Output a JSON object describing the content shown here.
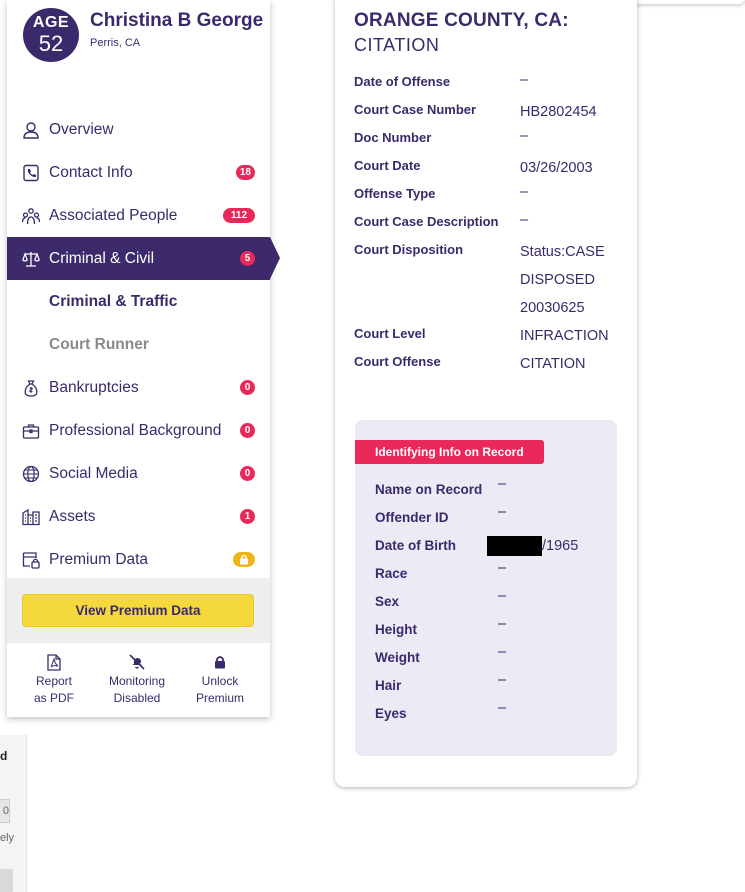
{
  "profile": {
    "age_label": "AGE",
    "age_value": "52",
    "name": "Christina B George",
    "location": "Perris, CA"
  },
  "nav": {
    "overview": {
      "label": "Overview",
      "icon": "person-icon"
    },
    "contact": {
      "label": "Contact Info",
      "badge": "18",
      "icon": "phone-icon"
    },
    "associated": {
      "label": "Associated People",
      "badge": "112",
      "icon": "people-icon"
    },
    "criminal": {
      "label": "Criminal & Civil",
      "badge": "5",
      "icon": "scales-icon"
    },
    "sub_criminal_traffic": "Criminal & Traffic",
    "sub_court_runner": "Court Runner",
    "bankruptcies": {
      "label": "Bankruptcies",
      "badge": "0",
      "icon": "money-bag-icon"
    },
    "professional": {
      "label": "Professional Background",
      "badge": "0",
      "icon": "briefcase-icon"
    },
    "social": {
      "label": "Social Media",
      "badge": "0",
      "icon": "globe-icon"
    },
    "assets": {
      "label": "Assets",
      "badge": "1",
      "icon": "buildings-icon"
    },
    "premium": {
      "label": "Premium Data",
      "icon": "premium-data-icon"
    }
  },
  "premium_button": "View Premium Data",
  "footer": {
    "pdf_line1": "Report",
    "pdf_line2": "as PDF",
    "monitor_line1": "Monitoring",
    "monitor_line2": "Disabled",
    "unlock_line1": "Unlock",
    "unlock_line2": "Premium"
  },
  "record": {
    "title": "ORANGE COUNTY, CA:",
    "subtitle": "CITATION",
    "fields": [
      {
        "label": "Date of Offense",
        "value": "–"
      },
      {
        "label": "Court Case Number",
        "value": "HB2802454"
      },
      {
        "label": "Doc Number",
        "value": "–"
      },
      {
        "label": "Court Date",
        "value": "03/26/2003"
      },
      {
        "label": "Offense Type",
        "value": "–"
      },
      {
        "label": "Court Case Description",
        "value": "–"
      },
      {
        "label": "Court Disposition",
        "value": "Status:CASE DISPOSED 20030625"
      },
      {
        "label": "Court Level",
        "value": "INFRACTION"
      },
      {
        "label": "Court Offense",
        "value": "CITATION"
      }
    ]
  },
  "identifying": {
    "tag": "Identifying Info on Record",
    "fields": [
      {
        "label": "Name on Record",
        "value": "–"
      },
      {
        "label": "Offender ID",
        "value": "–"
      },
      {
        "label": "Date of Birth",
        "value": "/1965"
      },
      {
        "label": "Race",
        "value": "–"
      },
      {
        "label": "Sex",
        "value": "–"
      },
      {
        "label": "Height",
        "value": "–"
      },
      {
        "label": "Weight",
        "value": "–"
      },
      {
        "label": "Hair",
        "value": "–"
      },
      {
        "label": "Eyes",
        "value": "–"
      }
    ]
  },
  "ghost": {
    "t1": "d",
    "t2": "0",
    "t3": "ely"
  },
  "colors": {
    "primary": "#3b2a6b",
    "accent": "#e8295a",
    "premium": "#f5d93c"
  }
}
